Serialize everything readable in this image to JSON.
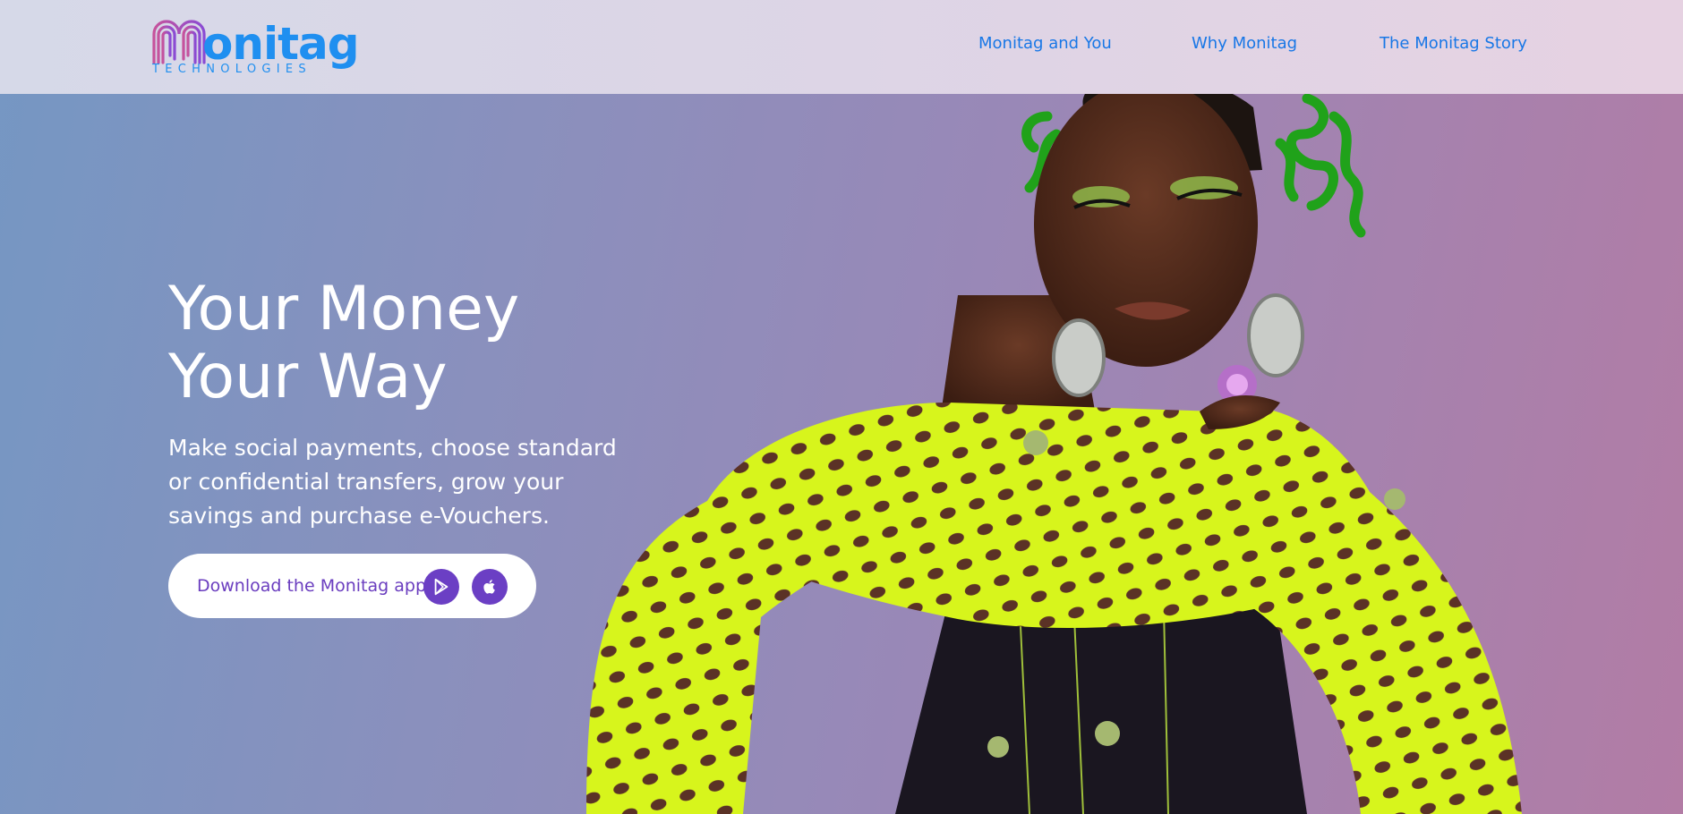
{
  "header": {
    "logo": {
      "word": "onitag",
      "sub": "TECHNOLOGIES"
    },
    "nav": [
      {
        "label": "Monitag and You"
      },
      {
        "label": "Why Monitag"
      },
      {
        "label": "The Monitag Story"
      }
    ]
  },
  "hero": {
    "title_line1": "Your Money",
    "title_line2": "Your Way",
    "subtitle": "Make social payments, choose standard or confidential transfers, grow your savings and purchase e-Vouchers.",
    "download_label": "Download the Monitag app",
    "store_icons": [
      "google-play-icon",
      "apple-icon"
    ]
  },
  "colors": {
    "brand_blue": "#1f8ff0",
    "nav_blue": "#1877e6",
    "button_purple": "#6b3fc4",
    "download_text": "#6a3dbf",
    "sweater_green": "#d4f21a"
  }
}
